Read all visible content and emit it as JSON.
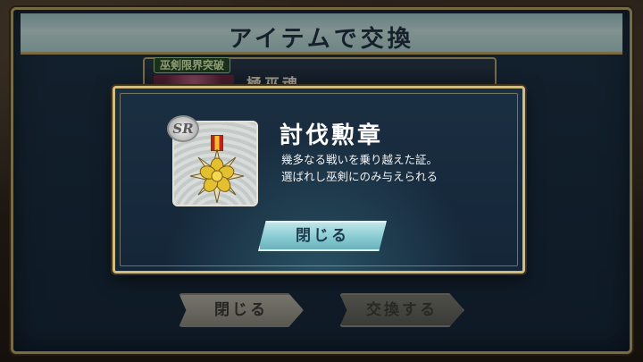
{
  "screen": {
    "title": "アイテムで交換"
  },
  "item_card": {
    "tag": "巫剣限界突破",
    "name": "極巫魂"
  },
  "outer_buttons": {
    "close_label": "閉じる",
    "exchange_label": "交換する"
  },
  "dialog": {
    "item_name": "討伐勲章",
    "rarity": "SR",
    "description_line1": "幾多なる戦いを乗り越えた証。",
    "description_line2": "選ばれし巫剣にのみ与えられる",
    "close_label": "閉じる"
  },
  "colors": {
    "frame_gold": "#d2bd80",
    "panel_navy": "#1b2f42",
    "button_cyan": "#8ccdd4"
  }
}
